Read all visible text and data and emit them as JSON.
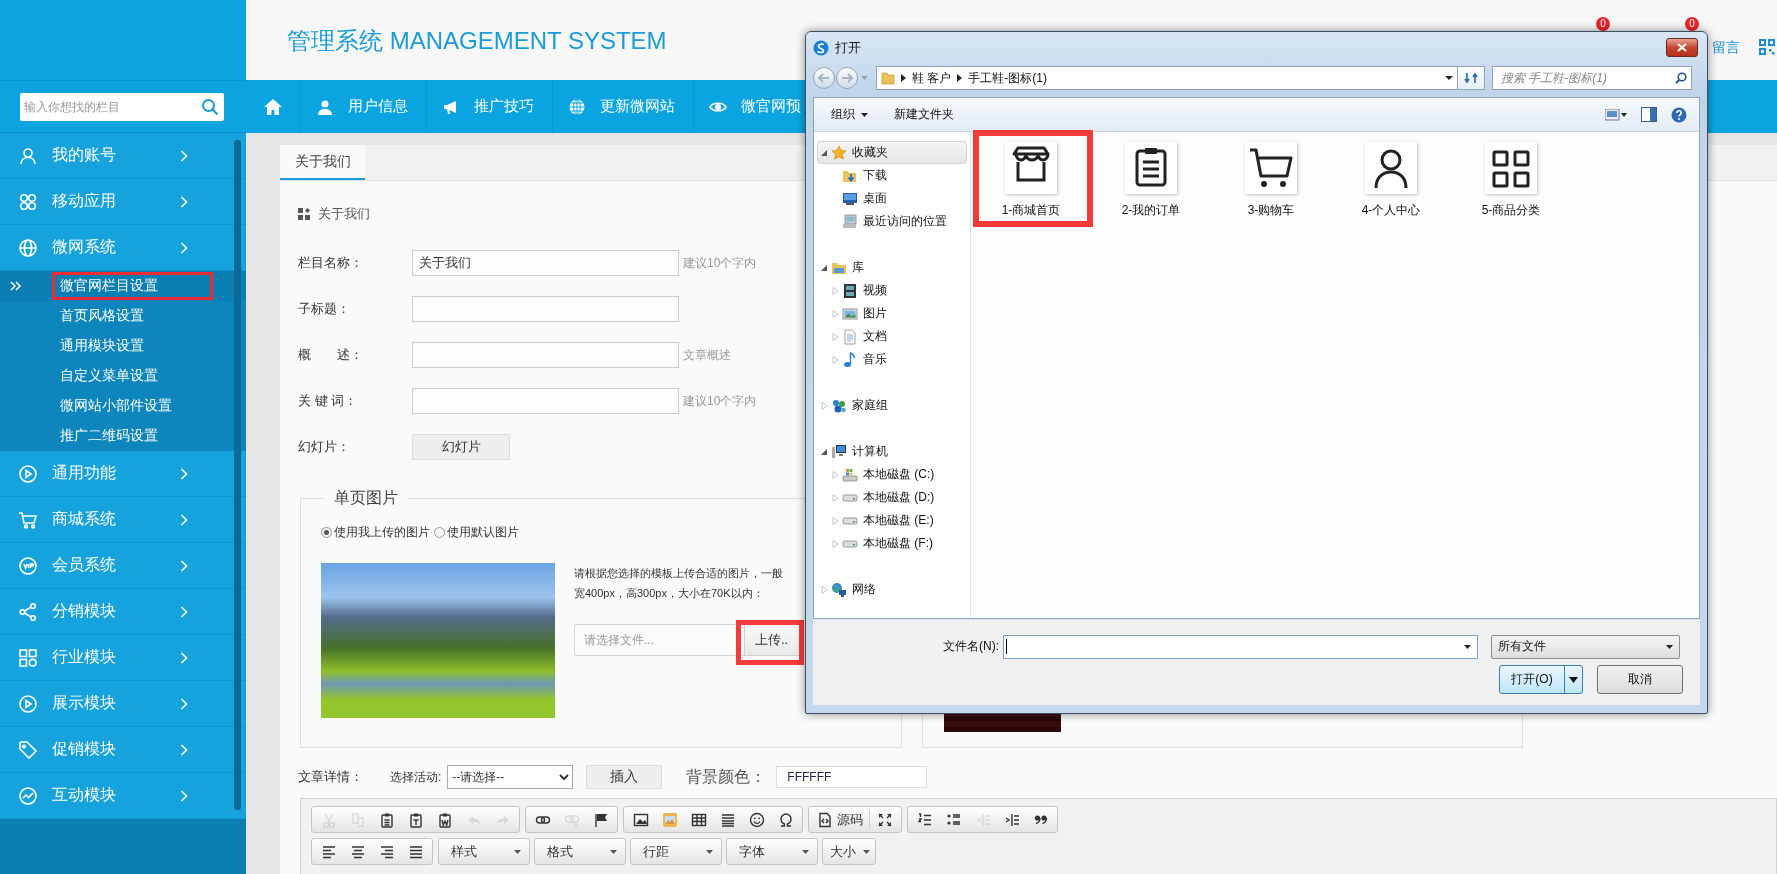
{
  "header": {
    "title": "管理系统 MANAGEMENT SYSTEM",
    "badges": [
      "0",
      "0"
    ],
    "message_link": "留言"
  },
  "sidebar": {
    "search": {
      "placeholder": "输入你想找的栏目"
    },
    "items": [
      {
        "label": "我的账号",
        "kind": "account"
      },
      {
        "label": "移动应用",
        "kind": "apps"
      },
      {
        "label": "微网系统",
        "kind": "site",
        "children": [
          {
            "label": "微官网栏目设置",
            "selected": true,
            "highlighted": true
          },
          {
            "label": "首页风格设置",
            "selected": false,
            "highlighted": false
          },
          {
            "label": "通用模块设置",
            "selected": false,
            "highlighted": false
          },
          {
            "label": "自定义菜单设置",
            "selected": false,
            "highlighted": false
          },
          {
            "label": "微网站小部件设置",
            "selected": false,
            "highlighted": false
          },
          {
            "label": "推广二维码设置",
            "selected": false,
            "highlighted": false
          }
        ]
      },
      {
        "label": "通用功能",
        "kind": "play"
      },
      {
        "label": "商城系统",
        "kind": "mall"
      },
      {
        "label": "会员系统",
        "kind": "member"
      },
      {
        "label": "分销模块",
        "kind": "share"
      },
      {
        "label": "行业模块",
        "kind": "grid"
      },
      {
        "label": "展示模块",
        "kind": "play"
      },
      {
        "label": "促销模块",
        "kind": "tag"
      },
      {
        "label": "互动模块",
        "kind": "chart"
      }
    ]
  },
  "nav": {
    "items": [
      {
        "label": "用户信息",
        "kind": "user"
      },
      {
        "label": "推广技巧",
        "kind": "megaphone"
      },
      {
        "label": "更新微网站",
        "kind": "globe"
      },
      {
        "label": "微官网预",
        "kind": "eye"
      }
    ]
  },
  "content": {
    "tab": {
      "label": "关于我们",
      "selected": true
    },
    "section_title": "关于我们",
    "fields": [
      {
        "label": "栏目名称：",
        "value": "关于我们",
        "hint": "建议10个字内"
      },
      {
        "label": "子标题："
      },
      {
        "label": "概　　述：",
        "hint": "文章概述"
      },
      {
        "label": "关 键 词：",
        "hint": "建议10个字内"
      }
    ],
    "slideshow": {
      "label": "幻灯片：",
      "button": "幻灯片"
    },
    "image_section": {
      "legend": "单页图片",
      "options": [
        {
          "label": "使用我上传的图片",
          "selected": true
        },
        {
          "label": "使用默认图片",
          "selected": false
        }
      ],
      "hint_lines": [
        "请根据您选择的模板上传合适的图片，一般",
        "宽400px，高300px，大小在70K以内："
      ],
      "file": {
        "placeholder": "请选择文件..."
      },
      "upload": {
        "label": "上传..",
        "highlighted": true
      }
    },
    "article": {
      "label": "文章详情：",
      "activity_label": "选择活动:",
      "activity_value": "--请选择--",
      "insert": "插入",
      "bg_label": "背景颜色：",
      "bg_value": "FFFFFF"
    },
    "editor": {
      "toolbar_rows": [
        {
          "groups": [
            {
              "buttons": [
                {
                  "kind": "cut",
                  "disabled": true
                },
                {
                  "kind": "copy",
                  "disabled": true
                },
                {
                  "kind": "paste",
                  "disabled": false
                },
                {
                  "kind": "paste-text",
                  "disabled": false
                },
                {
                  "kind": "paste-word",
                  "disabled": false
                },
                {
                  "kind": "undo",
                  "disabled": true
                },
                {
                  "kind": "redo",
                  "disabled": true
                }
              ]
            },
            {
              "buttons": [
                {
                  "kind": "link",
                  "disabled": false
                },
                {
                  "kind": "unlink",
                  "disabled": true
                },
                {
                  "kind": "anchor",
                  "disabled": false
                }
              ]
            },
            {
              "buttons": [
                {
                  "kind": "image",
                  "disabled": false
                },
                {
                  "kind": "picture",
                  "disabled": false
                },
                {
                  "kind": "table",
                  "disabled": false
                },
                {
                  "kind": "hr",
                  "disabled": false
                },
                {
                  "kind": "emoji",
                  "disabled": false
                },
                {
                  "kind": "special",
                  "disabled": false
                }
              ]
            },
            {
              "buttons": [
                {
                  "kind": "source",
                  "label": "源码",
                  "disabled": false
                },
                {
                  "kind": "fullscreen",
                  "disabled": false
                }
              ]
            },
            {
              "buttons": [
                {
                  "kind": "ol",
                  "disabled": false
                },
                {
                  "kind": "ul",
                  "disabled": false
                },
                {
                  "kind": "outdent",
                  "disabled": true
                },
                {
                  "kind": "indent",
                  "disabled": false
                },
                {
                  "kind": "quote",
                  "disabled": false
                }
              ]
            }
          ]
        },
        {
          "groups": [
            {
              "buttons": [
                {
                  "kind": "align-left",
                  "disabled": false
                },
                {
                  "kind": "align-center",
                  "disabled": false
                },
                {
                  "kind": "align-right",
                  "disabled": false
                },
                {
                  "kind": "justify",
                  "disabled": false
                }
              ]
            }
          ],
          "dropdowns": [
            "样式",
            "格式",
            "行距",
            "字体",
            "大小"
          ]
        }
      ]
    }
  },
  "dialog": {
    "title": "打开",
    "path": [
      "鞋 客户",
      "手工鞋-图标(1)"
    ],
    "search": {
      "placeholder": "搜索 手工鞋-图标(1)"
    },
    "toolbar": [
      "组织",
      "新建文件夹"
    ],
    "tree": [
      {
        "label": "收藏夹",
        "kind": "favorites",
        "expanded": true,
        "selected": true,
        "children": [
          {
            "label": "下载",
            "kind": "downloads",
            "selected": false
          },
          {
            "label": "桌面",
            "kind": "desktop",
            "selected": false
          },
          {
            "label": "最近访问的位置",
            "kind": "recent",
            "selected": false
          }
        ]
      },
      {
        "label": "库",
        "kind": "library",
        "expanded": true,
        "selected": false,
        "children": [
          {
            "label": "视频",
            "kind": "video",
            "expanded": false,
            "selected": false
          },
          {
            "label": "图片",
            "kind": "pictures",
            "expanded": false,
            "selected": false
          },
          {
            "label": "文档",
            "kind": "documents",
            "expanded": false,
            "selected": false
          },
          {
            "label": "音乐",
            "kind": "music",
            "expanded": false,
            "selected": false
          }
        ]
      },
      {
        "label": "家庭组",
        "kind": "homegroup",
        "expanded": false,
        "selected": false
      },
      {
        "label": "计算机",
        "kind": "computer",
        "expanded": true,
        "selected": false,
        "children": [
          {
            "label": "本地磁盘 (C:)",
            "kind": "system-drive",
            "expanded": false,
            "selected": false
          },
          {
            "label": "本地磁盘 (D:)",
            "kind": "drive",
            "expanded": false,
            "selected": false
          },
          {
            "label": "本地磁盘 (E:)",
            "kind": "drive",
            "expanded": false,
            "selected": false
          },
          {
            "label": "本地磁盘 (F:)",
            "kind": "drive",
            "expanded": false,
            "selected": false
          }
        ]
      },
      {
        "label": "网络",
        "kind": "network",
        "expanded": false,
        "selected": false
      }
    ],
    "files": [
      {
        "label": "1-商城首页",
        "kind": "store",
        "highlighted": true
      },
      {
        "label": "2-我的订单",
        "kind": "orders",
        "highlighted": false
      },
      {
        "label": "3-购物车",
        "kind": "cart",
        "highlighted": false
      },
      {
        "label": "4-个人中心",
        "kind": "person",
        "highlighted": false
      },
      {
        "label": "5-商品分类",
        "kind": "categories",
        "highlighted": false
      }
    ],
    "filename_label": "文件名(N):",
    "filetype": "所有文件",
    "buttons": [
      {
        "label": "打开(O)",
        "kind": "split"
      },
      {
        "label": "取消",
        "kind": "plain"
      }
    ]
  }
}
